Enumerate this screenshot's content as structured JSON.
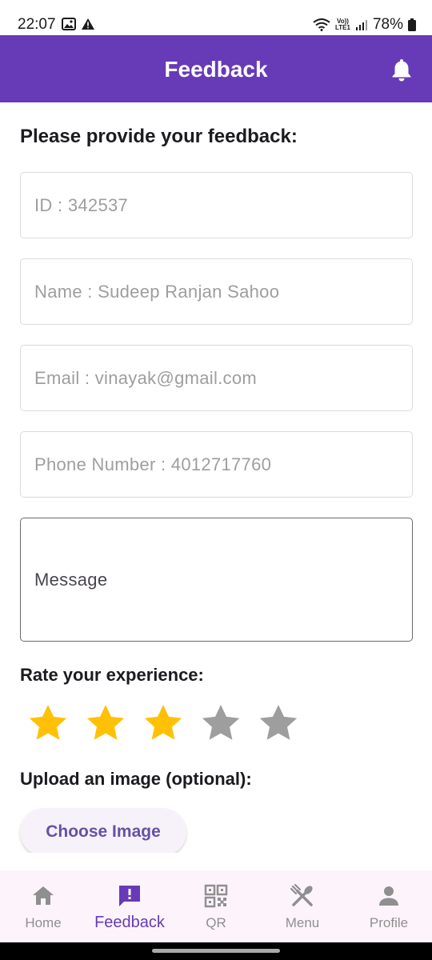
{
  "status_bar": {
    "time": "22:07",
    "battery": "78%",
    "network": "LTE1",
    "volte": "Vo))"
  },
  "app_bar": {
    "title": "Feedback",
    "bell_icon": "bell-icon",
    "color": "#673ab7"
  },
  "form": {
    "heading": "Please provide your feedback:",
    "id_field": "ID : 342537",
    "name_field": "Name : Sudeep Ranjan Sahoo",
    "email_field": "Email : vinayak@gmail.com",
    "phone_field": "Phone Number : 4012717760",
    "message_label": "Message"
  },
  "rating": {
    "label": "Rate your experience:",
    "value": 3,
    "max": 5,
    "filled_color": "#ffc107",
    "empty_color": "#9e9e9e"
  },
  "upload": {
    "label": "Upload an image (optional):",
    "button_label": "Choose Image"
  },
  "bottom_nav": {
    "items": [
      {
        "label": "Home",
        "icon": "home-icon",
        "active": false
      },
      {
        "label": "Feedback",
        "icon": "feedback-icon",
        "active": true
      },
      {
        "label": "QR",
        "icon": "qr-icon",
        "active": false
      },
      {
        "label": "Menu",
        "icon": "utensils-icon",
        "active": false
      },
      {
        "label": "Profile",
        "icon": "person-icon",
        "active": false
      }
    ]
  }
}
